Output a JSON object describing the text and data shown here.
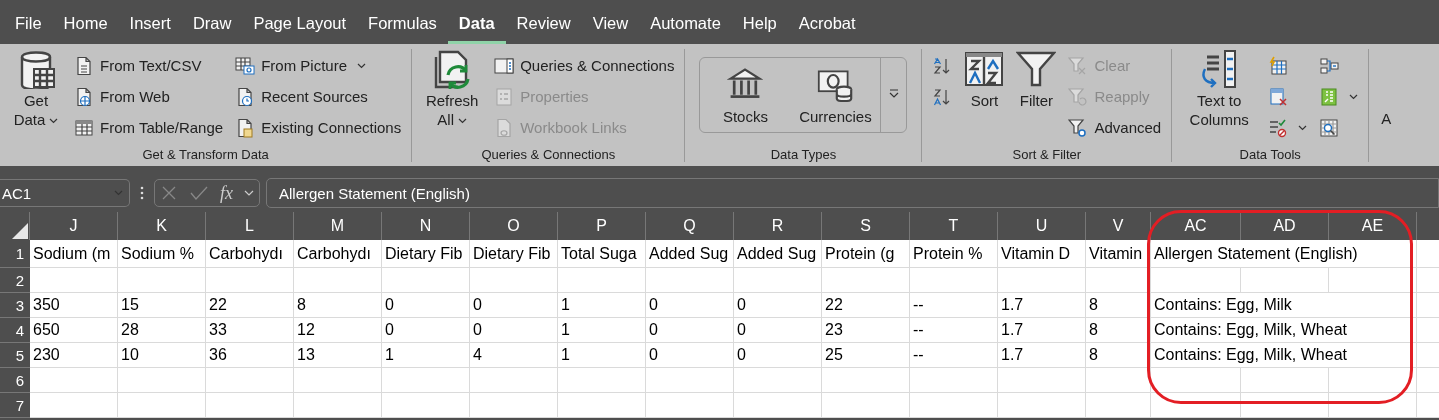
{
  "tabs": [
    {
      "label": "File",
      "selected": false
    },
    {
      "label": "Home",
      "selected": false
    },
    {
      "label": "Insert",
      "selected": false
    },
    {
      "label": "Draw",
      "selected": false
    },
    {
      "label": "Page Layout",
      "selected": false
    },
    {
      "label": "Formulas",
      "selected": false
    },
    {
      "label": "Data",
      "selected": true
    },
    {
      "label": "Review",
      "selected": false
    },
    {
      "label": "View",
      "selected": false
    },
    {
      "label": "Automate",
      "selected": false
    },
    {
      "label": "Help",
      "selected": false
    },
    {
      "label": "Acrobat",
      "selected": false
    }
  ],
  "ribbon": {
    "groups": [
      {
        "label": "Get & Transform Data",
        "items": [
          {
            "kind": "large",
            "label": "Get Data",
            "dropdown": true
          },
          {
            "kind": "column",
            "items": [
              {
                "label": "From Text/CSV",
                "dropdown": false,
                "disabled": false
              },
              {
                "label": "From Web",
                "dropdown": false,
                "disabled": false
              },
              {
                "label": "From Table/Range",
                "dropdown": false,
                "disabled": false
              }
            ]
          },
          {
            "kind": "column",
            "items": [
              {
                "label": "From Picture",
                "dropdown": true,
                "disabled": false
              },
              {
                "label": "Recent Sources",
                "dropdown": false,
                "disabled": false
              },
              {
                "label": "Existing Connections",
                "dropdown": false,
                "disabled": false
              }
            ]
          }
        ]
      },
      {
        "label": "Queries & Connections",
        "items": [
          {
            "kind": "large",
            "label": "Refresh All",
            "dropdown": true
          },
          {
            "kind": "column",
            "items": [
              {
                "label": "Queries & Connections",
                "dropdown": false,
                "disabled": false
              },
              {
                "label": "Properties",
                "dropdown": false,
                "disabled": true
              },
              {
                "label": "Workbook Links",
                "dropdown": false,
                "disabled": true
              }
            ]
          }
        ]
      },
      {
        "label": "Data Types",
        "items": [
          {
            "kind": "gallery",
            "items": [
              {
                "label": "Stocks"
              },
              {
                "label": "Currencies"
              }
            ]
          }
        ]
      },
      {
        "label": "Sort & Filter",
        "items": [
          {
            "kind": "column",
            "items": [
              {
                "dropdown": false,
                "disabled": false
              },
              {
                "dropdown": false,
                "disabled": false
              }
            ]
          },
          {
            "kind": "large",
            "label": "Sort",
            "dropdown": false
          },
          {
            "kind": "large",
            "label": "Filter",
            "dropdown": false
          },
          {
            "kind": "column",
            "items": [
              {
                "label": "Clear",
                "dropdown": false,
                "disabled": true
              },
              {
                "label": "Reapply",
                "dropdown": false,
                "disabled": true
              },
              {
                "label": "Advanced",
                "dropdown": false,
                "disabled": false
              }
            ]
          }
        ]
      },
      {
        "label": "Data Tools",
        "items": [
          {
            "kind": "large",
            "label": "Text to Columns",
            "dropdown": false
          },
          {
            "kind": "column",
            "items": [
              {
                "dropdown": false,
                "disabled": false
              },
              {
                "dropdown": false,
                "disabled": false
              },
              {
                "dropdown": true,
                "disabled": false
              }
            ]
          },
          {
            "kind": "column",
            "items": [
              {
                "dropdown": false,
                "disabled": false
              },
              {
                "dropdown": true,
                "disabled": false
              },
              {
                "dropdown": false,
                "disabled": false
              }
            ]
          }
        ]
      }
    ],
    "cut_off_label": "A"
  },
  "formula_bar": {
    "name_box": "AC1",
    "function_label": "fx",
    "formula": "Allergen Statement (English)"
  },
  "sheet": {
    "columns": [
      "J",
      "K",
      "L",
      "M",
      "N",
      "O",
      "P",
      "Q",
      "R",
      "S",
      "T",
      "U",
      "V",
      "AC",
      "AD",
      "AE"
    ],
    "rows": [
      {
        "number": "1",
        "cells": [
          "Sodium (m",
          "Sodium %",
          "Carbohydı",
          "Carbohydı",
          "Dietary Fib",
          "Dietary Fib",
          "Total Suga",
          "Added Sug",
          "Added Sug",
          "Protein (g",
          "Protein %",
          "Vitamin D",
          "Vitamin",
          "Allergen Statement (English)"
        ]
      },
      {
        "number": "2"
      },
      {
        "number": "3",
        "cells": [
          "350",
          "15",
          "22",
          "8",
          "0",
          "0",
          "1",
          "0",
          "0",
          "22",
          "--",
          "1.7",
          "8",
          "Contains: Egg, Milk"
        ]
      },
      {
        "number": "4",
        "cells": [
          "650",
          "28",
          "33",
          "12",
          "0",
          "0",
          "1",
          "0",
          "0",
          "23",
          "--",
          "1.7",
          "8",
          "Contains: Egg, Milk, Wheat"
        ]
      },
      {
        "number": "5",
        "cells": [
          "230",
          "10",
          "36",
          "13",
          "1",
          "4",
          "1",
          "0",
          "0",
          "25",
          "--",
          "1.7",
          "8",
          "Contains: Egg, Milk, Wheat"
        ]
      },
      {
        "number": "6"
      },
      {
        "number": "7"
      }
    ]
  },
  "annotation": {
    "kind": "rounded-outline",
    "color": "#e31e24"
  }
}
